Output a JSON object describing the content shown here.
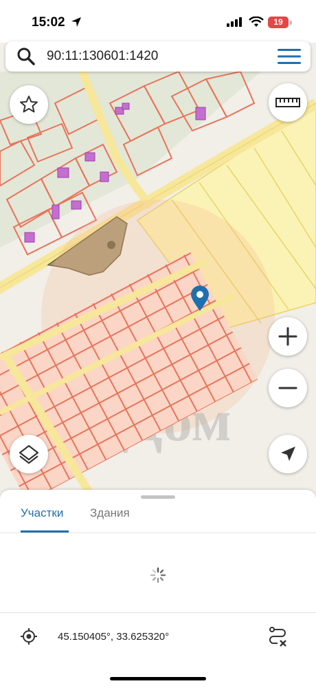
{
  "status_bar": {
    "time": "15:02",
    "battery": "19",
    "icons": [
      "location-arrow-icon",
      "signal-icon",
      "wifi-icon",
      "battery-icon"
    ]
  },
  "search": {
    "value": "90:11:130601:1420"
  },
  "map": {
    "watermark": "ингиДом",
    "colors": {
      "background": "#f2efe9",
      "parcel_outline": "#e8735a",
      "parcel_fill": "#fbd6c6",
      "plot_yellow": "#fbf3b5",
      "road": "#f7e79a",
      "building": "#c46fcf",
      "pin": "#1e6fb0"
    }
  },
  "controls": {
    "favorite": "star-icon",
    "ruler": "ruler-icon",
    "zoom_in": "plus-icon",
    "zoom_out": "minus-icon",
    "layers": "layers-icon",
    "locate": "navigation-arrow-icon"
  },
  "sheet": {
    "tabs": [
      {
        "label": "Участки",
        "active": true
      },
      {
        "label": "Здания",
        "active": false
      }
    ],
    "coordinates": "45.150405°, 33.625320°"
  },
  "accent_color": "#1e6fb0"
}
